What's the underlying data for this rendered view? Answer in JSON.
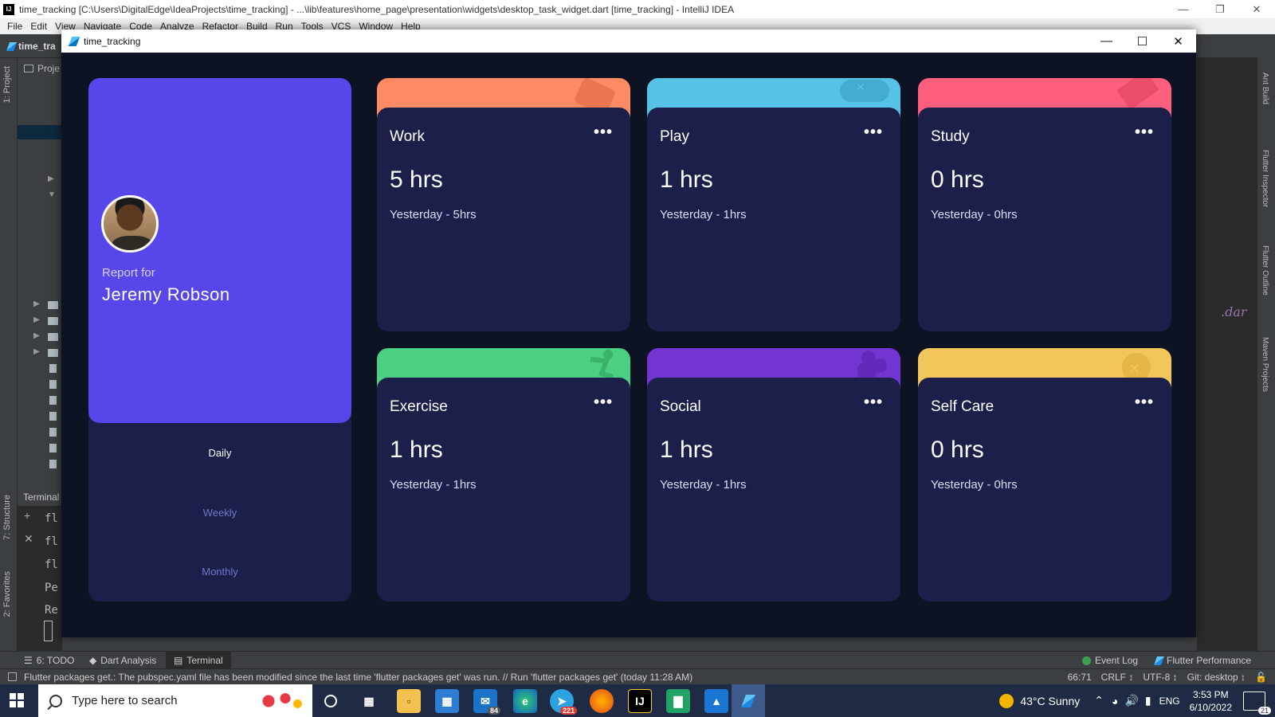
{
  "ide": {
    "title": "time_tracking [C:\\Users\\DigitalEdge\\IdeaProjects\\time_tracking] - ...\\lib\\features\\home_page\\presentation\\widgets\\desktop_task_widget.dart [time_tracking] - IntelliJ IDEA",
    "menu": [
      "File",
      "Edit",
      "View",
      "Navigate",
      "Code",
      "Analyze",
      "Refactor",
      "Build",
      "Run",
      "Tools",
      "VCS",
      "Window",
      "Help"
    ],
    "project_crumb": "time_tra",
    "project_tab": "1: Project",
    "project_head": "Proje",
    "structure_tab": "7: Structure",
    "favorites_tab": "2: Favorites",
    "terminal_head": "Terminal",
    "terminal_lines": [
      "fl",
      "fl",
      "fl",
      "Pe",
      "Re"
    ],
    "code_fragment": ".dar",
    "right_tabs": [
      "Ant Build",
      "Flutter Inspector",
      "Flutter Outline",
      "Maven Projects"
    ],
    "toolwindows": {
      "todo": "6: TODO",
      "dart_analysis": "Dart Analysis",
      "terminal": "Terminal",
      "event_log": "Event Log",
      "flutter_performance": "Flutter Performance"
    },
    "status_message": "Flutter packages get.: The pubspec.yaml file has been modified since the last time 'flutter packages get' was run. // Run 'flutter packages get' (today 11:28 AM)",
    "status_right": [
      "66:71",
      "CRLF ↕",
      "UTF-8 ↕",
      "Git: desktop ↕"
    ]
  },
  "app": {
    "window_title": "time_tracking",
    "profile": {
      "report_for": "Report for",
      "name": "Jeremy Robson"
    },
    "periods": {
      "daily": "Daily",
      "weekly": "Weekly",
      "monthly": "Monthly"
    },
    "tasks": [
      {
        "title": "Work",
        "hours": "5 hrs",
        "previous": "Yesterday - 5hrs",
        "color": "#ff8b64"
      },
      {
        "title": "Play",
        "hours": "1 hrs",
        "previous": "Yesterday - 1hrs",
        "color": "#55c2e6"
      },
      {
        "title": "Study",
        "hours": "0 hrs",
        "previous": "Yesterday - 0hrs",
        "color": "#ff5e7d"
      },
      {
        "title": "Exercise",
        "hours": "1 hrs",
        "previous": "Yesterday - 1hrs",
        "color": "#4bcf82"
      },
      {
        "title": "Social",
        "hours": "1 hrs",
        "previous": "Yesterday - 1hrs",
        "color": "#7335d2"
      },
      {
        "title": "Self Care",
        "hours": "0 hrs",
        "previous": "Yesterday - 0hrs",
        "color": "#f1c75b"
      }
    ],
    "menu_dots": "•••"
  },
  "taskbar": {
    "search_placeholder": "Type here to search",
    "mail_badge": "84",
    "telegram_badge": "221",
    "weather": "43°C  Sunny",
    "language": "ENG",
    "time": "3:53 PM",
    "date": "6/10/2022",
    "notifications": "21"
  },
  "colors": {
    "app_bg": "#0d1323",
    "card_bg": "#1c1f4a",
    "profile_accent": "#5746ea",
    "period_inactive": "#7078c9"
  }
}
